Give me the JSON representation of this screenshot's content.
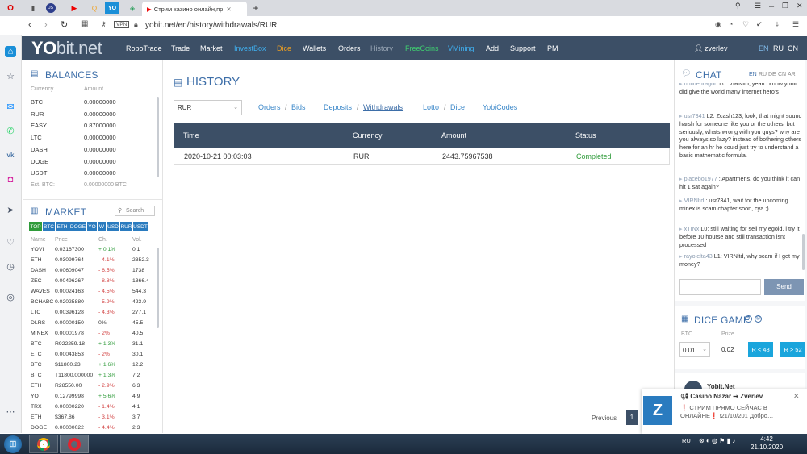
{
  "browser": {
    "active_tab_title": "Стрим казино онлайн,пр",
    "url": "yobit.net/en/history/withdrawals/RUR",
    "vpn": "VPN",
    "pinned_tabs": [
      "YO"
    ]
  },
  "nav": {
    "logo_main": "YO",
    "logo_rest": "bit.net",
    "items": [
      "RoboTrade",
      "Trade",
      "Market",
      "InvestBox",
      "Dice",
      "Wallets",
      "Orders",
      "History",
      "FreeCoins",
      "VMining",
      "Add",
      "Support",
      "PM"
    ],
    "username": "zverlev",
    "langs": [
      "EN",
      "RU",
      "CN"
    ]
  },
  "balances": {
    "title": "BALANCES",
    "col_currency": "Currency",
    "col_amount": "Amount",
    "rows": [
      {
        "cur": "BTC",
        "amt": "0.00000000"
      },
      {
        "cur": "RUR",
        "amt": "0.00000000"
      },
      {
        "cur": "EASY",
        "amt": "0.87000000"
      },
      {
        "cur": "LTC",
        "amt": "0.00000000"
      },
      {
        "cur": "DASH",
        "amt": "0.00000000"
      },
      {
        "cur": "DOGE",
        "amt": "0.00000000"
      },
      {
        "cur": "USDT",
        "amt": "0.00000000"
      }
    ],
    "est_label": "Est. BTC:",
    "est_value": "0.00000000 BTC"
  },
  "market": {
    "title": "MARKET",
    "search_placeholder": "Search",
    "tabs": [
      "TOP",
      "BTC",
      "ETH",
      "DOGE",
      "YO",
      "W",
      "USD",
      "RUR",
      "USDT"
    ],
    "col_name": "Name",
    "col_price": "Price",
    "col_change": "Ch.",
    "col_vol": "Vol.",
    "rows": [
      {
        "name": "YOVI",
        "price": "0.03167300",
        "ch": "+ 0.1%",
        "dir": "up",
        "vol": "0.1"
      },
      {
        "name": "ETH",
        "price": "0.03099764",
        "ch": "- 4.1%",
        "dir": "dn",
        "vol": "2352.3"
      },
      {
        "name": "DASH",
        "price": "0.00609047",
        "ch": "- 6.5%",
        "dir": "dn",
        "vol": "1738"
      },
      {
        "name": "ZEC",
        "price": "0.00496267",
        "ch": "- 8.8%",
        "dir": "dn",
        "vol": "1366.4"
      },
      {
        "name": "WAVES",
        "price": "0.00024163",
        "ch": "- 4.5%",
        "dir": "dn",
        "vol": "544.3"
      },
      {
        "name": "BCHABC",
        "price": "0.02025880",
        "ch": "- 5.9%",
        "dir": "dn",
        "vol": "423.9"
      },
      {
        "name": "LTC",
        "price": "0.00396128",
        "ch": "- 4.3%",
        "dir": "dn",
        "vol": "277.1"
      },
      {
        "name": "DLRS",
        "price": "0.00000150",
        "ch": "0%",
        "dir": "flat",
        "vol": "45.5"
      },
      {
        "name": "MINEX",
        "price": "0.00001978",
        "ch": "- 2%",
        "dir": "dn",
        "vol": "40.5"
      },
      {
        "name": "BTC",
        "price": "R922259.18",
        "ch": "+ 1.3%",
        "dir": "up",
        "vol": "31.1"
      },
      {
        "name": "ETC",
        "price": "0.00043853",
        "ch": "- 2%",
        "dir": "dn",
        "vol": "30.1"
      },
      {
        "name": "BTC",
        "price": "$11800.23",
        "ch": "+ 1.6%",
        "dir": "up",
        "vol": "12.2"
      },
      {
        "name": "BTC",
        "price": "T11800.000000",
        "ch": "+ 1.3%",
        "dir": "up",
        "vol": "7.2"
      },
      {
        "name": "ETH",
        "price": "R28550.00",
        "ch": "- 2.9%",
        "dir": "dn",
        "vol": "6.3"
      },
      {
        "name": "YO",
        "price": "0.12799998",
        "ch": "+ 5.6%",
        "dir": "up",
        "vol": "4.9"
      },
      {
        "name": "TRX",
        "price": "0.00000220",
        "ch": "- 1.4%",
        "dir": "dn",
        "vol": "4.1"
      },
      {
        "name": "ETH",
        "price": "$367.86",
        "ch": "- 3.1%",
        "dir": "dn",
        "vol": "3.7"
      },
      {
        "name": "DOGE",
        "price": "0.00000022",
        "ch": "- 4.4%",
        "dir": "dn",
        "vol": "2.3"
      }
    ]
  },
  "history": {
    "title": "HISTORY",
    "currency_select": "RUR",
    "links": [
      "Orders",
      "Bids",
      "Deposits",
      "Withdrawals",
      "Lotto",
      "Dice",
      "YobiCodes"
    ],
    "columns": [
      "Time",
      "Currency",
      "Amount",
      "Status"
    ],
    "rows": [
      {
        "time": "2020-10-21 00:03:03",
        "currency": "RUR",
        "amount": "2443.75967538",
        "status": "Completed"
      }
    ],
    "prev": "Previous",
    "page": "1"
  },
  "chat": {
    "title": "CHAT",
    "langs": [
      "EN",
      "RU",
      "DE",
      "CN",
      "AR"
    ],
    "messages": [
      {
        "user": "onlinedragon",
        "text": "L0: VIRNltd, yeah i know yobit did give the world many internet hero's"
      },
      {
        "user": "usr7341",
        "text": "L2: Zcash123, look, that might sound harsh for someone like you or the others. but seriously, whats wrong with you guys? why are you always so lazy? instead of bothering others here for an hr he could just try to understand a basic mathematic formula."
      },
      {
        "user": "placebo1977",
        "text": ": Apartmens, do you think it can hit 1 sat again?"
      },
      {
        "user": "VIRNltd",
        "text": ": usr7341, wait for the upcoming minex is scam chapter soon, cya ;)"
      },
      {
        "user": "xTINx",
        "text": "L0: still waiting for sell my egold, i try it before 10 hourse and still transaction isnt processed"
      },
      {
        "user": "rayolelta43",
        "text": "L1: VIRNltd, why scam if I get my money?"
      }
    ],
    "send": "Send"
  },
  "dice": {
    "title": "DICE GAME",
    "bet_label": "BTC",
    "prize_label": "Prize",
    "bet_value": "0.01",
    "prize_value": "0.02",
    "btn_low": "R < 48",
    "btn_high": "R > 52"
  },
  "promo": {
    "name": "Yobit.Net"
  },
  "notification": {
    "title": "Casino Nazar ➞ Zverlev",
    "body": "❗ СТРИМ ПРЯМО СЕЙЧАС В ОНЛАЙНЕ❗ !21/10/201 Добро…"
  },
  "taskbar": {
    "lang": "RU",
    "time": "4:42",
    "date": "21.10.2020"
  }
}
